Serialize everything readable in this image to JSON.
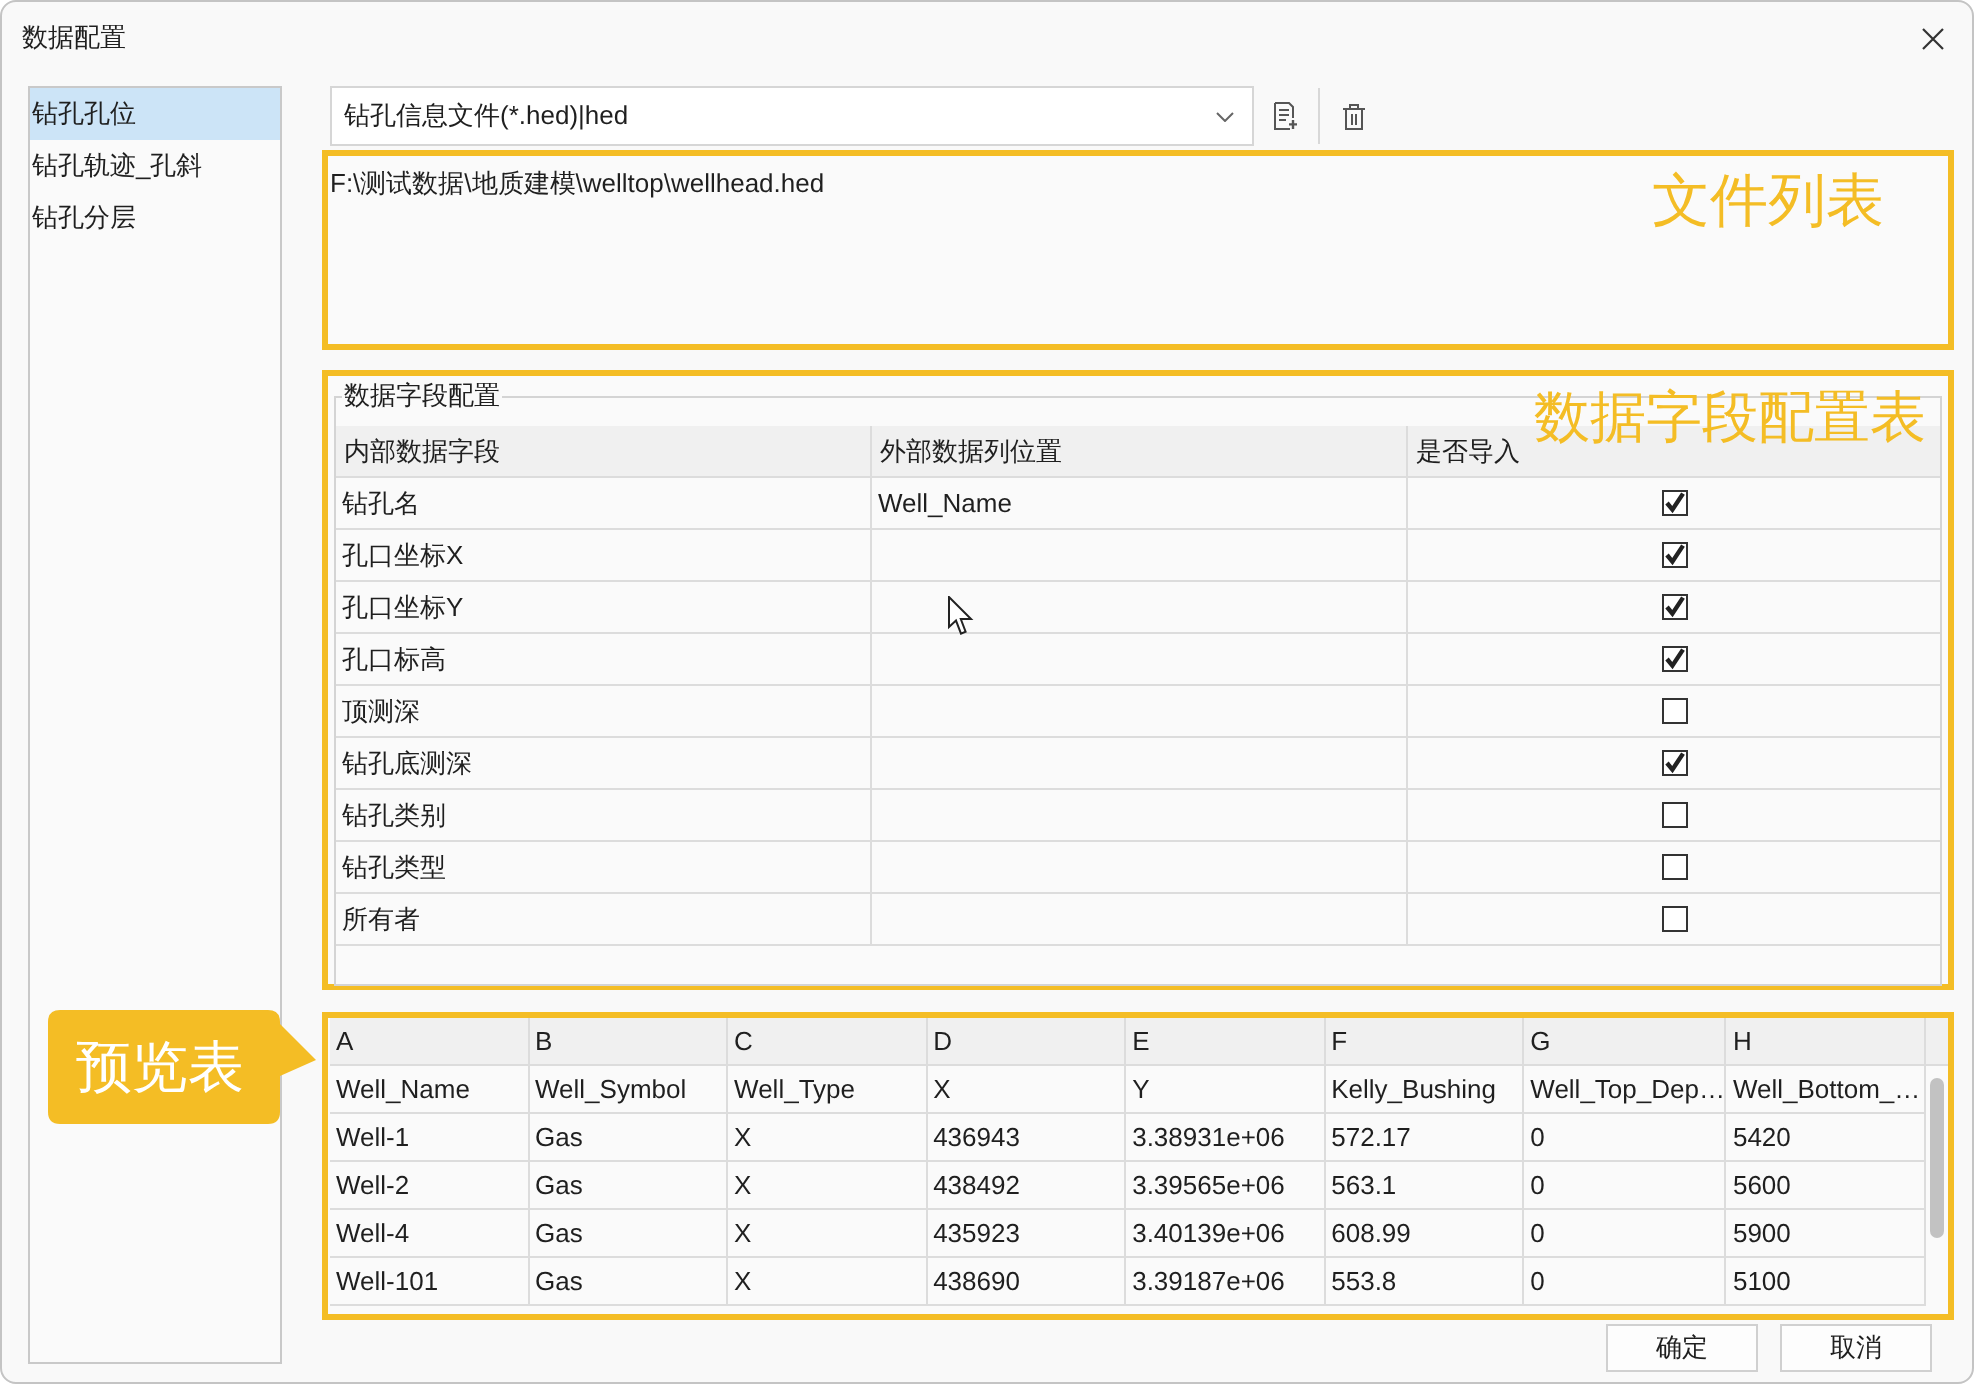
{
  "window": {
    "title": "数据配置"
  },
  "sidebar": {
    "items": [
      {
        "label": "钻孔孔位",
        "selected": true
      },
      {
        "label": "钻孔轨迹_孔斜",
        "selected": false
      },
      {
        "label": "钻孔分层",
        "selected": false
      }
    ]
  },
  "file_type": {
    "value": "钻孔信息文件(*.hed)|hed"
  },
  "file_list": {
    "annotation": "文件列表",
    "items": [
      "F:\\测试数据\\地质建模\\welltop\\wellhead.hed"
    ]
  },
  "field_config": {
    "title": "数据字段配置",
    "annotation": "数据字段配置表",
    "columns": [
      "内部数据字段",
      "外部数据列位置",
      "是否导入"
    ],
    "rows": [
      {
        "field": "钻孔名",
        "column": "Well_Name",
        "checked": true
      },
      {
        "field": "孔口坐标X",
        "checked": true
      },
      {
        "field": "孔口坐标Y",
        "checked": true
      },
      {
        "field": "孔口标高",
        "checked": true
      },
      {
        "field": "顶测深",
        "checked": false
      },
      {
        "field": "钻孔底测深",
        "checked": true
      },
      {
        "field": "钻孔类别",
        "checked": false
      },
      {
        "field": "钻孔类型",
        "checked": false
      },
      {
        "field": "所有者",
        "checked": false
      }
    ]
  },
  "preview": {
    "annotation": "预览表",
    "columns": [
      "A",
      "B",
      "C",
      "D",
      "E",
      "F",
      "G",
      "H"
    ],
    "rows": [
      [
        "Well_Name",
        "Well_Symbol",
        "Well_Type",
        "X",
        "Y",
        "Kelly_Bushing",
        "Well_Top_Dep…",
        "Well_Bottom_…"
      ],
      [
        "Well-1",
        "Gas",
        "X",
        "436943",
        "3.38931e+06",
        "572.17",
        "0",
        "5420"
      ],
      [
        "Well-2",
        "Gas",
        "X",
        "438492",
        "3.39565e+06",
        "563.1",
        "0",
        "5600"
      ],
      [
        "Well-4",
        "Gas",
        "X",
        "435923",
        "3.40139e+06",
        "608.99",
        "0",
        "5900"
      ],
      [
        "Well-101",
        "Gas",
        "X",
        "438690",
        "3.39187e+06",
        "553.8",
        "0",
        "5100"
      ]
    ]
  },
  "buttons": [
    "确定",
    "取消"
  ]
}
